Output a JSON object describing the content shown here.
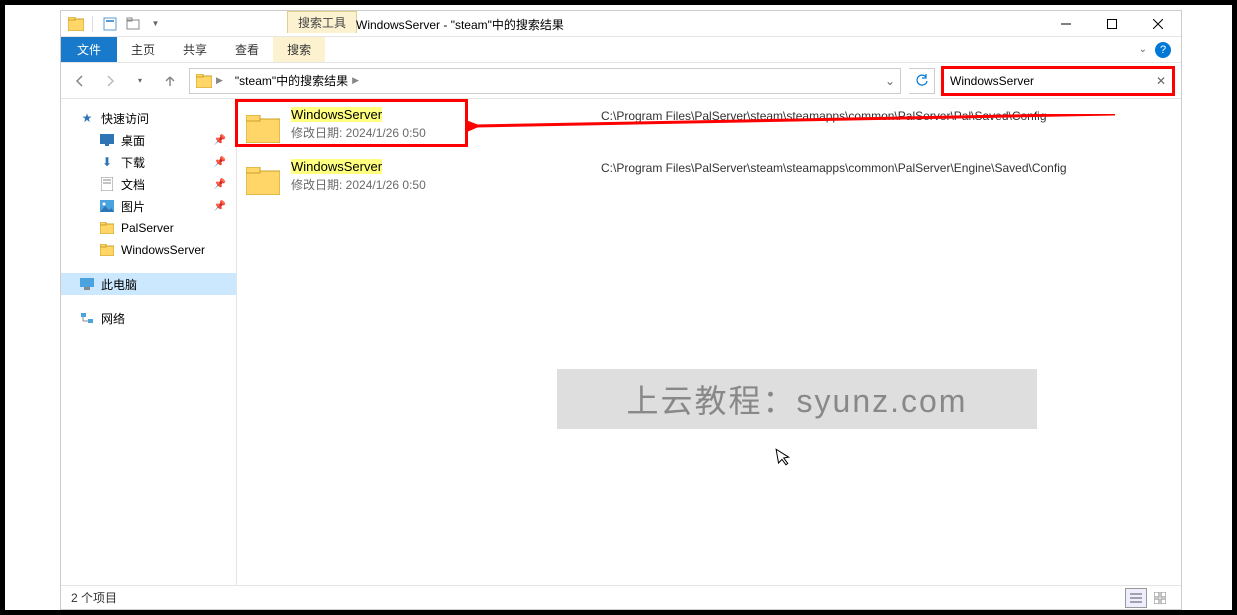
{
  "titlebar": {
    "context_tab": "搜索工具",
    "title": "WindowsServer - \"steam\"中的搜索结果"
  },
  "ribbon": {
    "file": "文件",
    "tabs": [
      "主页",
      "共享",
      "查看",
      "搜索"
    ]
  },
  "address": {
    "crumb1": "\"steam\"中的搜索结果"
  },
  "search": {
    "value": "WindowsServer"
  },
  "sidebar": {
    "quick_access": "快速访问",
    "items": [
      {
        "icon": "desktop",
        "label": "桌面",
        "pinned": true
      },
      {
        "icon": "download",
        "label": "下载",
        "pinned": true
      },
      {
        "icon": "document",
        "label": "文档",
        "pinned": true
      },
      {
        "icon": "picture",
        "label": "图片",
        "pinned": true
      },
      {
        "icon": "folder",
        "label": "PalServer",
        "pinned": false
      },
      {
        "icon": "folder",
        "label": "WindowsServer",
        "pinned": false
      }
    ],
    "this_pc": "此电脑",
    "network": "网络"
  },
  "results": [
    {
      "name_prefix": "W",
      "name_highlight": "indowsServer",
      "date_label": "修改日期: ",
      "date_value": "2024/1/26 0:50",
      "path": "C:\\Program Files\\PalServer\\steam\\steamapps\\common\\PalServer\\Pal\\Saved\\Config"
    },
    {
      "name_prefix": "W",
      "name_highlight": "indowsServer",
      "date_label": "修改日期: ",
      "date_value": "2024/1/26 0:50",
      "path": "C:\\Program Files\\PalServer\\steam\\steamapps\\common\\PalServer\\Engine\\Saved\\Config"
    }
  ],
  "watermark": "上云教程：syunz.com",
  "status": {
    "count": "2 个项目"
  }
}
